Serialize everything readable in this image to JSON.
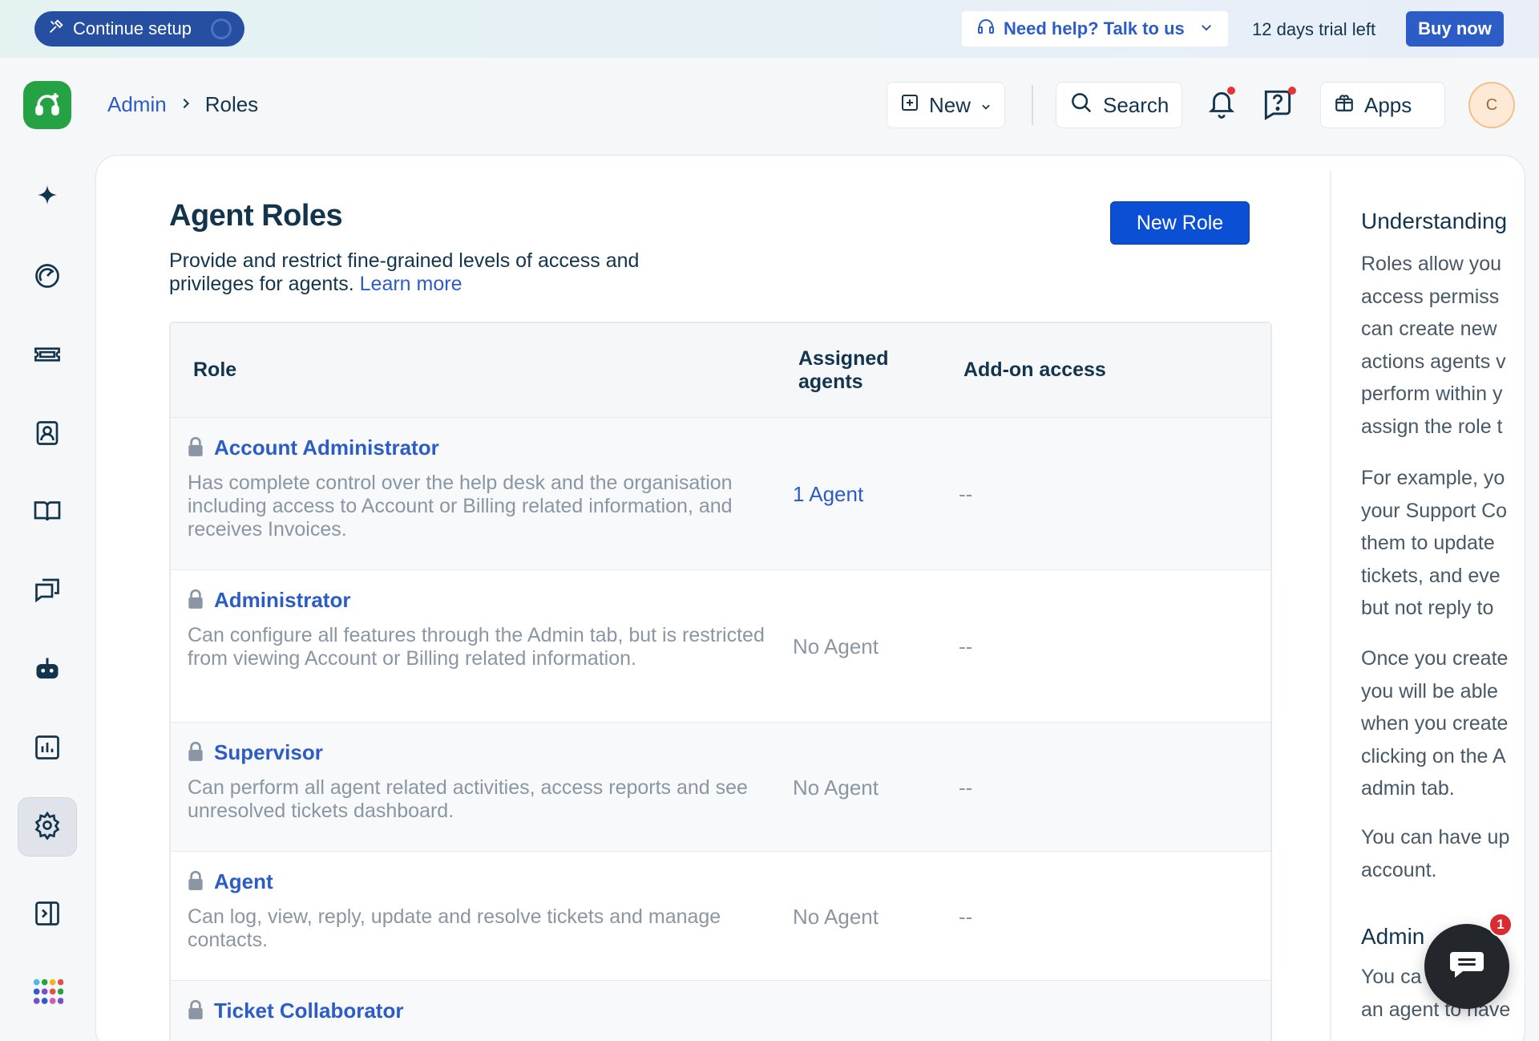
{
  "banner": {
    "continue_label": "Continue setup",
    "help_label": "Need help? Talk to us",
    "trial_text": "12 days trial left",
    "buy_label": "Buy now"
  },
  "header": {
    "breadcrumb_root": "Admin",
    "breadcrumb_current": "Roles",
    "new_label": "New",
    "search_label": "Search",
    "apps_label": "Apps",
    "avatar_initial": "C"
  },
  "sidebar": {
    "items": [
      {
        "icon": "sparkle-icon"
      },
      {
        "icon": "dashboard-icon"
      },
      {
        "icon": "ticket-icon"
      },
      {
        "icon": "contacts-icon"
      },
      {
        "icon": "knowledge-base-icon"
      },
      {
        "icon": "conversations-icon"
      },
      {
        "icon": "bot-icon"
      },
      {
        "icon": "analytics-icon"
      },
      {
        "icon": "admin-gear-icon",
        "active": true
      },
      {
        "icon": "expand-sidebar-icon"
      },
      {
        "icon": "app-switcher-icon"
      }
    ]
  },
  "page": {
    "title": "Agent Roles",
    "description": "Provide and restrict fine-grained levels of access and privileges for agents.",
    "learn_more": "Learn more",
    "new_role_label": "New Role"
  },
  "table": {
    "headers": {
      "role": "Role",
      "assigned_line1": "Assigned",
      "assigned_line2": "agents",
      "addon": "Add-on access"
    },
    "rows": [
      {
        "name": "Account Administrator",
        "description": "Has complete control over the help desk and the organisation including access to Account or Billing related information, and receives Invoices.",
        "agents": "1 Agent",
        "addon": "--"
      },
      {
        "name": "Administrator",
        "description": "Can configure all features through the Admin tab, but is restricted from viewing Account or Billing related information.",
        "agents": "No Agent",
        "addon": "--"
      },
      {
        "name": "Supervisor",
        "description": "Can perform all agent related activities, access reports and see unresolved tickets dashboard.",
        "agents": "No Agent",
        "addon": "--"
      },
      {
        "name": "Agent",
        "description": "Can log, view, reply, update and resolve tickets and manage contacts.",
        "agents": "No Agent",
        "addon": "--"
      },
      {
        "name": "Ticket Collaborator",
        "description": "",
        "agents": "",
        "addon": ""
      }
    ]
  },
  "help_panel": {
    "heading": "Understanding",
    "para1": [
      "Roles allow you",
      "access permiss",
      "can create new",
      "actions agents v",
      "perform within y",
      "assign the role t"
    ],
    "para2": [
      "For example, yo",
      "your Support Co",
      "them to update",
      "tickets, and eve",
      "but not reply to"
    ],
    "para3": [
      "Once you create",
      "you will be able",
      "when you create",
      "clicking on the A",
      "admin tab."
    ],
    "para4": [
      "You can have up",
      "account."
    ],
    "heading2": "Admin",
    "para5": [
      "You ca",
      "an agent to have"
    ]
  },
  "chat": {
    "badge": "1"
  },
  "colors": {
    "primary": "#2c5cc5",
    "brand_green": "#25a244",
    "button_blue": "#0b4fd4"
  }
}
